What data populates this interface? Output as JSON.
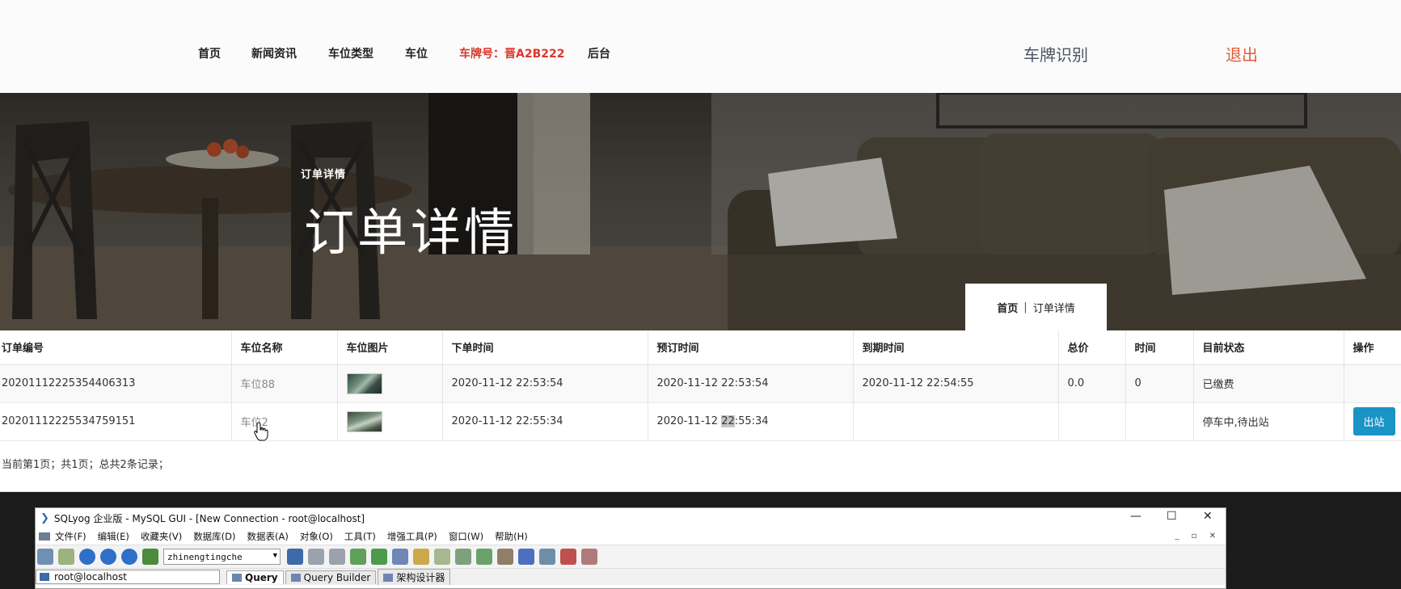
{
  "nav": {
    "items": [
      "首页",
      "新闻资讯",
      "车位类型",
      "车位"
    ],
    "plate": "车牌号：晋A2B222",
    "backend": "后台",
    "plate_recognition": "车牌识别",
    "logout": "退出"
  },
  "hero": {
    "small_title": "订单详情",
    "title": "订单详情",
    "breadcrumb_home": "首页",
    "breadcrumb_sep": "|",
    "breadcrumb_current": "订单详情"
  },
  "table": {
    "headers": [
      "订单编号",
      "车位名称",
      "车位图片",
      "下单时间",
      "预订时间",
      "到期时间",
      "总价",
      "时间",
      "目前状态",
      "操作"
    ],
    "rows": [
      {
        "order_no": "20201112225354406313",
        "space_name": "车位88",
        "order_time": "2020-11-12 22:53:54",
        "reserve_time": "2020-11-12 22:53:54",
        "expire_time": "2020-11-12 22:54:55",
        "total_price": "0.0",
        "duration": "0",
        "status": "已缴费",
        "action": ""
      },
      {
        "order_no": "20201112225534759151",
        "space_name": "车位2",
        "order_time": "2020-11-12 22:55:34",
        "reserve_time_a": "2020-11-12 ",
        "reserve_time_b": "22",
        "reserve_time_c": ":55:34",
        "expire_time": "",
        "total_price": "",
        "duration": "",
        "status": "停车中,待出站",
        "action": "出站"
      }
    ],
    "pager": "当前第1页；共1页；总共2条记录；"
  },
  "sqlyog": {
    "title": "SQLyog 企业版 - MySQL GUI - [New Connection - root@localhost]",
    "menu": [
      "文件(F)",
      "编辑(E)",
      "收藏夹(V)",
      "数据库(D)",
      "数据表(A)",
      "对象(O)",
      "工具(T)",
      "增强工具(P)",
      "窗口(W)",
      "帮助(H)"
    ],
    "database": "zhinengtingche",
    "connection": "root@localhost",
    "tabs": [
      "Query",
      "Query Builder",
      "架构设计器"
    ],
    "controls": {
      "minimize": "—",
      "maximize": "☐",
      "close": "✕"
    }
  },
  "colors": {
    "plate_red": "#d9372c",
    "logout_orange": "#e65a3b",
    "button_blue": "#1a93c5"
  }
}
